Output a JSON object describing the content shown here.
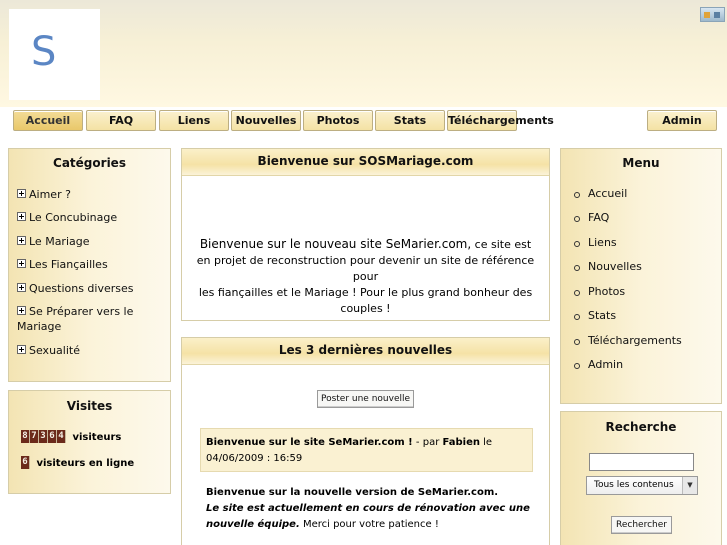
{
  "header": {
    "logo_letter": "S"
  },
  "nav": {
    "tabs": [
      "Accueil",
      "FAQ",
      "Liens",
      "Nouvelles",
      "Photos",
      "Stats",
      "Téléchargements"
    ],
    "admin": "Admin"
  },
  "categories": {
    "title": "Catégories",
    "items": [
      "Aimer ?",
      "Le Concubinage",
      "Le Mariage",
      "Les Fiançailles",
      "Questions diverses",
      "Se Préparer vers le",
      "Mariage",
      "Sexualité"
    ]
  },
  "visits": {
    "title": "Visites",
    "counter_digits": [
      "8",
      "7",
      "3",
      "6",
      "4"
    ],
    "counter_label": "visiteurs",
    "online_digits": [
      "6"
    ],
    "online_label": "visiteurs en ligne"
  },
  "welcome": {
    "title": "Bienvenue sur SOSMariage.com",
    "lead": "Bienvenue sur le nouveau site SeMarier.com,",
    "line1_rest": " ce site est",
    "line2": "en projet de reconstruction pour devenir un site de référence pour",
    "line3": "les fiançailles et le Mariage ! Pour le plus grand bonheur des",
    "line4": "couples !"
  },
  "news": {
    "title": "Les 3 dernières nouvelles",
    "post_button": "Poster une nouvelle",
    "item": {
      "headline": "Bienvenue sur le site SeMarier.com !",
      "by": " - par ",
      "author": "Fabien",
      "le": " le",
      "date": "04/06/2009 : 16:59",
      "body_line1": "Bienvenue sur la nouvelle version de SeMarier.com.",
      "body_line2": "Le site est actuellement en cours de rénovation avec une",
      "body_line3_em": "nouvelle équipe.",
      "body_line3_rest": " Merci pour votre patience !"
    }
  },
  "menu": {
    "title": "Menu",
    "items": [
      "Accueil",
      "FAQ",
      "Liens",
      "Nouvelles",
      "Photos",
      "Stats",
      "Téléchargements",
      "Admin"
    ]
  },
  "search": {
    "title": "Recherche",
    "input_value": "",
    "select_value": "Tous les contenus",
    "button": "Rechercher"
  }
}
